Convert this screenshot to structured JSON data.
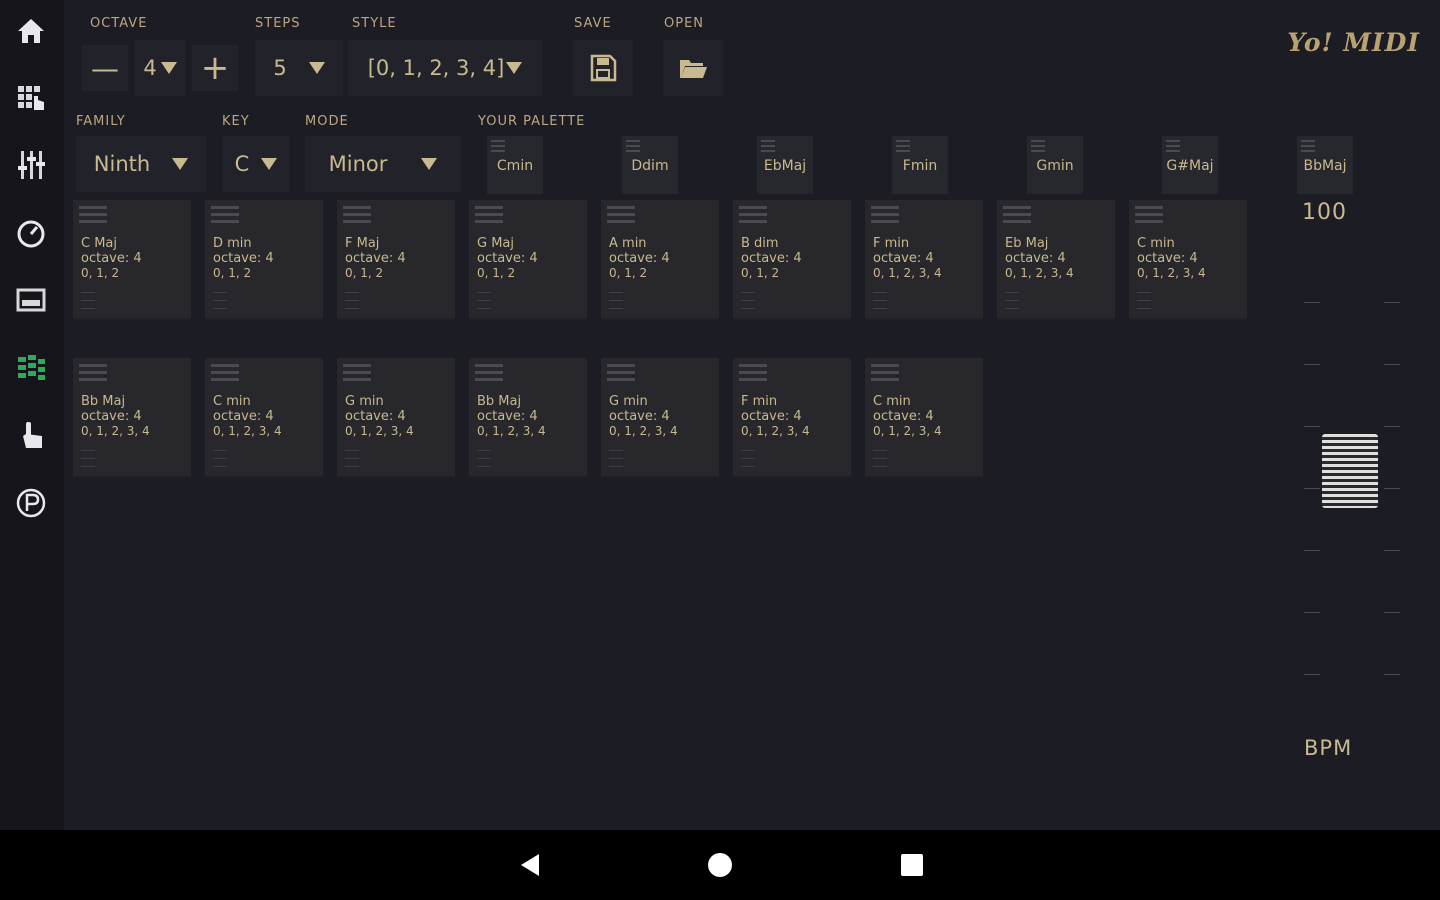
{
  "app": {
    "logo": "Yo! MIDI"
  },
  "toolbar": {
    "octave_label": "OCTAVE",
    "octave_minus": "—",
    "octave_value": "4",
    "octave_plus": "+",
    "steps_label": "STEPS",
    "steps_value": "5",
    "style_label": "STYLE",
    "style_value": "[0, 1, 2, 3, 4]",
    "save_label": "SAVE",
    "open_label": "OPEN"
  },
  "selectors": {
    "family_label": "FAMILY",
    "family_value": "Ninth",
    "key_label": "KEY",
    "key_value": "C",
    "mode_label": "MODE",
    "mode_value": "Minor",
    "palette_label": "YOUR PALETTE"
  },
  "palette": [
    "Cmin",
    "Ddim",
    "EbMaj",
    "Fmin",
    "Gmin",
    "G#Maj",
    "BbMaj"
  ],
  "chords": [
    {
      "name": "C Maj",
      "octave": "octave: 4",
      "notes": "0, 1, 2"
    },
    {
      "name": "D min",
      "octave": "octave: 4",
      "notes": "0, 1, 2"
    },
    {
      "name": "F Maj",
      "octave": "octave: 4",
      "notes": "0, 1, 2"
    },
    {
      "name": "G Maj",
      "octave": "octave: 4",
      "notes": "0, 1, 2"
    },
    {
      "name": "A min",
      "octave": "octave: 4",
      "notes": "0, 1, 2"
    },
    {
      "name": "B dim",
      "octave": "octave: 4",
      "notes": "0, 1, 2"
    },
    {
      "name": "F min",
      "octave": "octave: 4",
      "notes": "0, 1, 2, 3, 4"
    },
    {
      "name": "Eb Maj",
      "octave": "octave: 4",
      "notes": "0, 1, 2, 3, 4"
    },
    {
      "name": "C min",
      "octave": "octave: 4",
      "notes": "0, 1, 2, 3, 4"
    },
    {
      "name": "Bb Maj",
      "octave": "octave: 4",
      "notes": "0, 1, 2, 3, 4"
    },
    {
      "name": "C min",
      "octave": "octave: 4",
      "notes": "0, 1, 2, 3, 4"
    },
    {
      "name": "G min",
      "octave": "octave: 4",
      "notes": "0, 1, 2, 3, 4"
    },
    {
      "name": "Bb Maj",
      "octave": "octave: 4",
      "notes": "0, 1, 2, 3, 4"
    },
    {
      "name": "G min",
      "octave": "octave: 4",
      "notes": "0, 1, 2, 3, 4"
    },
    {
      "name": "F min",
      "octave": "octave: 4",
      "notes": "0, 1, 2, 3, 4"
    },
    {
      "name": "C min",
      "octave": "octave: 4",
      "notes": "0, 1, 2, 3, 4"
    }
  ],
  "tempo": {
    "value": "100",
    "unit": "BPM"
  },
  "sidebar": [
    "home-icon",
    "keyboard-icon",
    "mixer-icon",
    "gauge-icon",
    "pads-icon",
    "chords-icon",
    "touch-icon",
    "p-icon"
  ],
  "colors": {
    "accent": "#c9b98f",
    "background": "#1c1c24",
    "active_icon": "#2faa5c"
  }
}
